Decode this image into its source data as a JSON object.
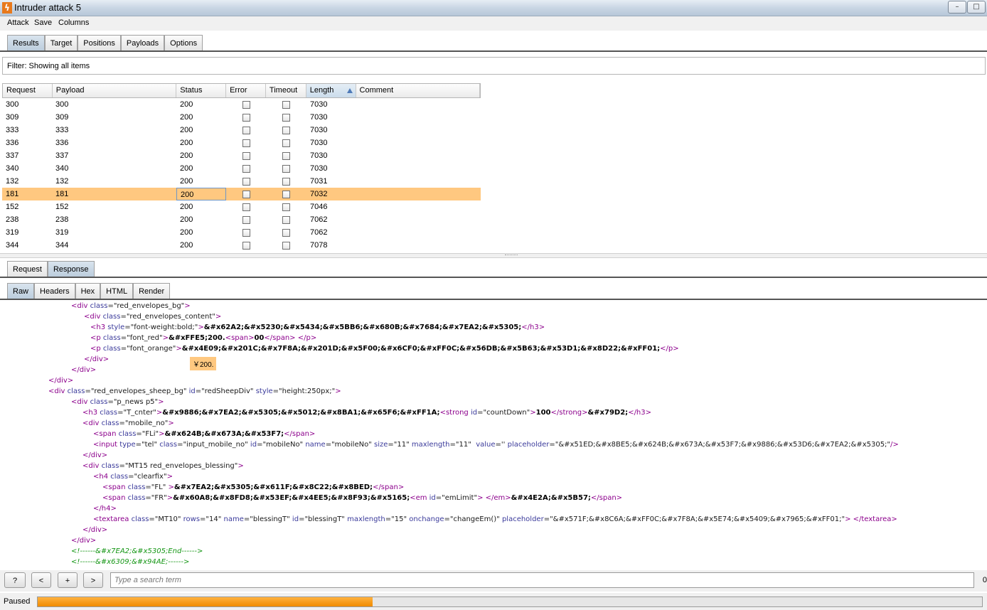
{
  "window": {
    "title": "Intruder attack 5",
    "min": "–",
    "max": "□"
  },
  "menu": [
    "Attack",
    "Save",
    "Columns"
  ],
  "main_tabs": [
    "Results",
    "Target",
    "Positions",
    "Payloads",
    "Options"
  ],
  "filter": "Filter:  Showing all items",
  "table": {
    "headers": [
      "Request",
      "Payload",
      "Status",
      "Error",
      "Timeout",
      "Length",
      "Comment"
    ],
    "sort_column": "Length",
    "rows": [
      {
        "request": "300",
        "payload": "300",
        "status": "200",
        "length": "7030"
      },
      {
        "request": "309",
        "payload": "309",
        "status": "200",
        "length": "7030"
      },
      {
        "request": "333",
        "payload": "333",
        "status": "200",
        "length": "7030"
      },
      {
        "request": "336",
        "payload": "336",
        "status": "200",
        "length": "7030"
      },
      {
        "request": "337",
        "payload": "337",
        "status": "200",
        "length": "7030"
      },
      {
        "request": "340",
        "payload": "340",
        "status": "200",
        "length": "7030"
      },
      {
        "request": "132",
        "payload": "132",
        "status": "200",
        "length": "7031"
      },
      {
        "request": "181",
        "payload": "181",
        "status": "200",
        "length": "7032",
        "selected": true
      },
      {
        "request": "152",
        "payload": "152",
        "status": "200",
        "length": "7046"
      },
      {
        "request": "238",
        "payload": "238",
        "status": "200",
        "length": "7062"
      },
      {
        "request": "319",
        "payload": "319",
        "status": "200",
        "length": "7062"
      },
      {
        "request": "344",
        "payload": "344",
        "status": "200",
        "length": "7078"
      }
    ]
  },
  "detail_tabs": [
    "Request",
    "Response"
  ],
  "view_tabs": [
    "Raw",
    "Headers",
    "Hex",
    "HTML",
    "Render"
  ],
  "code_lines": [
    [
      [
        "tg",
        "<div "
      ],
      [
        "an",
        "class"
      ],
      [
        "av",
        "=\"red_envelopes_bg\""
      ],
      [
        "tg",
        ">"
      ]
    ],
    [
      [
        "tg",
        "<div "
      ],
      [
        "an",
        "class"
      ],
      [
        "av",
        "=\"red_envelopes_content\""
      ],
      [
        "tg",
        ">"
      ]
    ],
    [
      [
        "tg",
        "<h3 "
      ],
      [
        "an",
        "style"
      ],
      [
        "av",
        "=\"font-weight:bold;\""
      ],
      [
        "tg",
        ">"
      ],
      [
        "tx",
        "&#x62A2;&#x5230;&#x5434;&#x5BB6;&#x680B;&#x7684;&#x7EA2;&#x5305;"
      ],
      [
        "tg",
        "</h3>"
      ]
    ],
    [
      [
        "tg",
        "<p "
      ],
      [
        "an",
        "class"
      ],
      [
        "av",
        "=\"font_red\""
      ],
      [
        "tg",
        ">"
      ],
      [
        "tx",
        "&#xFFE5;200."
      ],
      [
        "tg",
        "<span>"
      ],
      [
        "tx",
        "00"
      ],
      [
        "tg",
        "</span> </p>"
      ]
    ],
    [
      [
        "tg",
        "<p "
      ],
      [
        "an",
        "class"
      ],
      [
        "av",
        "=\"font_orange\""
      ],
      [
        "tg",
        ">"
      ],
      [
        "tx",
        "&#x4E09;&#x201C;&#x7F8A;&#x201D;&#x5F00;&#x6CF0;&#xFF0C;&#x56DB;&#x5B63;&#x53D1;&#x8D22;&#xFF01;"
      ],
      [
        "tg",
        "</p>"
      ]
    ],
    [
      [
        "tg",
        "</div>"
      ]
    ],
    [
      [
        "tg",
        "</div>"
      ]
    ],
    [
      [
        "tg",
        "</div>"
      ]
    ],
    [
      [
        "tg",
        "<div "
      ],
      [
        "an",
        "class"
      ],
      [
        "av",
        "=\"red_envelopes_sheep_bg\" "
      ],
      [
        "an",
        "id"
      ],
      [
        "av",
        "=\"redSheepDiv\" "
      ],
      [
        "an",
        "style"
      ],
      [
        "av",
        "=\"height:250px;\""
      ],
      [
        "tg",
        ">"
      ]
    ],
    [
      [
        "tg",
        "<div "
      ],
      [
        "an",
        "class"
      ],
      [
        "av",
        "=\"p_news p5\""
      ],
      [
        "tg",
        ">"
      ]
    ],
    [
      [
        "tg",
        "<h3 "
      ],
      [
        "an",
        "class"
      ],
      [
        "av",
        "=\"T_cnter\""
      ],
      [
        "tg",
        ">"
      ],
      [
        "tx",
        "&#x9886;&#x7EA2;&#x5305;&#x5012;&#x8BA1;&#x65F6;&#xFF1A;"
      ],
      [
        "tg",
        "<strong "
      ],
      [
        "an",
        "id"
      ],
      [
        "av",
        "=\"countDown\""
      ],
      [
        "tg",
        ">"
      ],
      [
        "tx",
        "100"
      ],
      [
        "tg",
        "</strong>"
      ],
      [
        "tx",
        "&#x79D2;"
      ],
      [
        "tg",
        "</h3>"
      ]
    ],
    [
      [
        "tg",
        "<div "
      ],
      [
        "an",
        "class"
      ],
      [
        "av",
        "=\"mobile_no\""
      ],
      [
        "tg",
        ">"
      ]
    ],
    [
      [
        "tg",
        "<span "
      ],
      [
        "an",
        "class"
      ],
      [
        "av",
        "=\"FLi\""
      ],
      [
        "tg",
        ">"
      ],
      [
        "tx",
        "&#x624B;&#x673A;&#x53F7;"
      ],
      [
        "tg",
        "</span>"
      ]
    ],
    [
      [
        "tg",
        "<input "
      ],
      [
        "an",
        "type"
      ],
      [
        "av",
        "=\"tel\" "
      ],
      [
        "an",
        "class"
      ],
      [
        "av",
        "=\"input_mobile_no\" "
      ],
      [
        "an",
        "id"
      ],
      [
        "av",
        "=\"mobileNo\" "
      ],
      [
        "an",
        "name"
      ],
      [
        "av",
        "=\"mobileNo\" "
      ],
      [
        "an",
        "size"
      ],
      [
        "av",
        "=\"11\" "
      ],
      [
        "an",
        "maxlength"
      ],
      [
        "av",
        "=\"11\"  "
      ],
      [
        "an",
        "value"
      ],
      [
        "av",
        "='' "
      ],
      [
        "an",
        "placeholder"
      ],
      [
        "av",
        "=\"&#x51ED;&#x8BE5;&#x624B;&#x673A;&#x53F7;&#x9886;&#x53D6;&#x7EA2;&#x5305;\""
      ],
      [
        "tg",
        "/>"
      ]
    ],
    [
      [
        "tg",
        "</div>"
      ]
    ],
    [
      [
        "tg",
        "<div "
      ],
      [
        "an",
        "class"
      ],
      [
        "av",
        "=\"MT15 red_envelopes_blessing\""
      ],
      [
        "tg",
        ">"
      ]
    ],
    [
      [
        "tg",
        "<h4 "
      ],
      [
        "an",
        "class"
      ],
      [
        "av",
        "=\"clearfix\""
      ],
      [
        "tg",
        ">"
      ]
    ],
    [
      [
        "tg",
        "<span "
      ],
      [
        "an",
        "class"
      ],
      [
        "av",
        "=\"FL\" "
      ],
      [
        "tg",
        ">"
      ],
      [
        "tx",
        "&#x7EA2;&#x5305;&#x611F;&#x8C22;&#x8BED;"
      ],
      [
        "tg",
        "</span>"
      ]
    ],
    [
      [
        "tg",
        "<span "
      ],
      [
        "an",
        "class"
      ],
      [
        "av",
        "=\"FR\""
      ],
      [
        "tg",
        ">"
      ],
      [
        "tx",
        "&#x60A8;&#x8FD8;&#x53EF;&#x4EE5;&#x8F93;&#x5165;"
      ],
      [
        "tg",
        "<em "
      ],
      [
        "an",
        "id"
      ],
      [
        "av",
        "=\"emLimit\""
      ],
      [
        "tg",
        "> </em>"
      ],
      [
        "tx",
        "&#x4E2A;&#x5B57;"
      ],
      [
        "tg",
        "</span>"
      ]
    ],
    [
      [
        "tg",
        "</h4>"
      ]
    ],
    [
      [
        "tg",
        "<textarea "
      ],
      [
        "an",
        "class"
      ],
      [
        "av",
        "=\"MT10\" "
      ],
      [
        "an",
        "rows"
      ],
      [
        "av",
        "=\"14\" "
      ],
      [
        "an",
        "name"
      ],
      [
        "av",
        "=\"blessingT\" "
      ],
      [
        "an",
        "id"
      ],
      [
        "av",
        "=\"blessingT\" "
      ],
      [
        "an",
        "maxlength"
      ],
      [
        "av",
        "=\"15\" "
      ],
      [
        "an",
        "onchange"
      ],
      [
        "av",
        "=\"changeEm()\" "
      ],
      [
        "an",
        "placeholder"
      ],
      [
        "av",
        "=\"&#x571F;&#x8C6A;&#xFF0C;&#x7F8A;&#x5E74;&#x5409;&#x7965;&#xFF01;\""
      ],
      [
        "tg",
        "> </textarea>"
      ]
    ],
    [
      [
        "tg",
        "</div>"
      ]
    ],
    [
      [
        "tg",
        "</div>"
      ]
    ],
    [
      [
        "cm",
        "<!------&#x7EA2;&#x5305;End------>"
      ]
    ],
    [
      [
        "cm",
        "<!------&#x6309;&#x94AE;------>"
      ]
    ]
  ],
  "tooltip": "￥200.",
  "search": {
    "placeholder": "Type a search term",
    "buttons": [
      "?",
      "<",
      "+",
      ">"
    ],
    "match_count": "0"
  },
  "status": {
    "label": "Paused",
    "progress": 0.355
  }
}
